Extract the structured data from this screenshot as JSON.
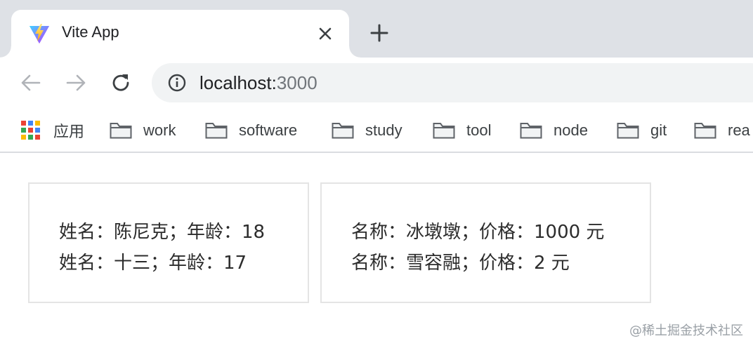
{
  "browser": {
    "tab": {
      "title": "Vite App",
      "favicon": "vite-logo-icon"
    },
    "address": {
      "host": "localhost:",
      "port": "3000"
    }
  },
  "bookmarks": {
    "apps_label": "应用",
    "folders": [
      "work",
      "software",
      "study",
      "tool",
      "node",
      "git",
      "rea"
    ]
  },
  "content": {
    "people": [
      "姓名：陈尼克；年龄：18",
      "姓名：十三；年龄：17"
    ],
    "products": [
      "名称：冰墩墩；价格：1000 元",
      "名称：雪容融；价格：2 元"
    ]
  },
  "watermark": "@稀土掘金技术社区",
  "colors": {
    "tabstrip": "#dee1e6",
    "omnibox": "#f1f3f4",
    "card_border": "#e4e4e4"
  }
}
